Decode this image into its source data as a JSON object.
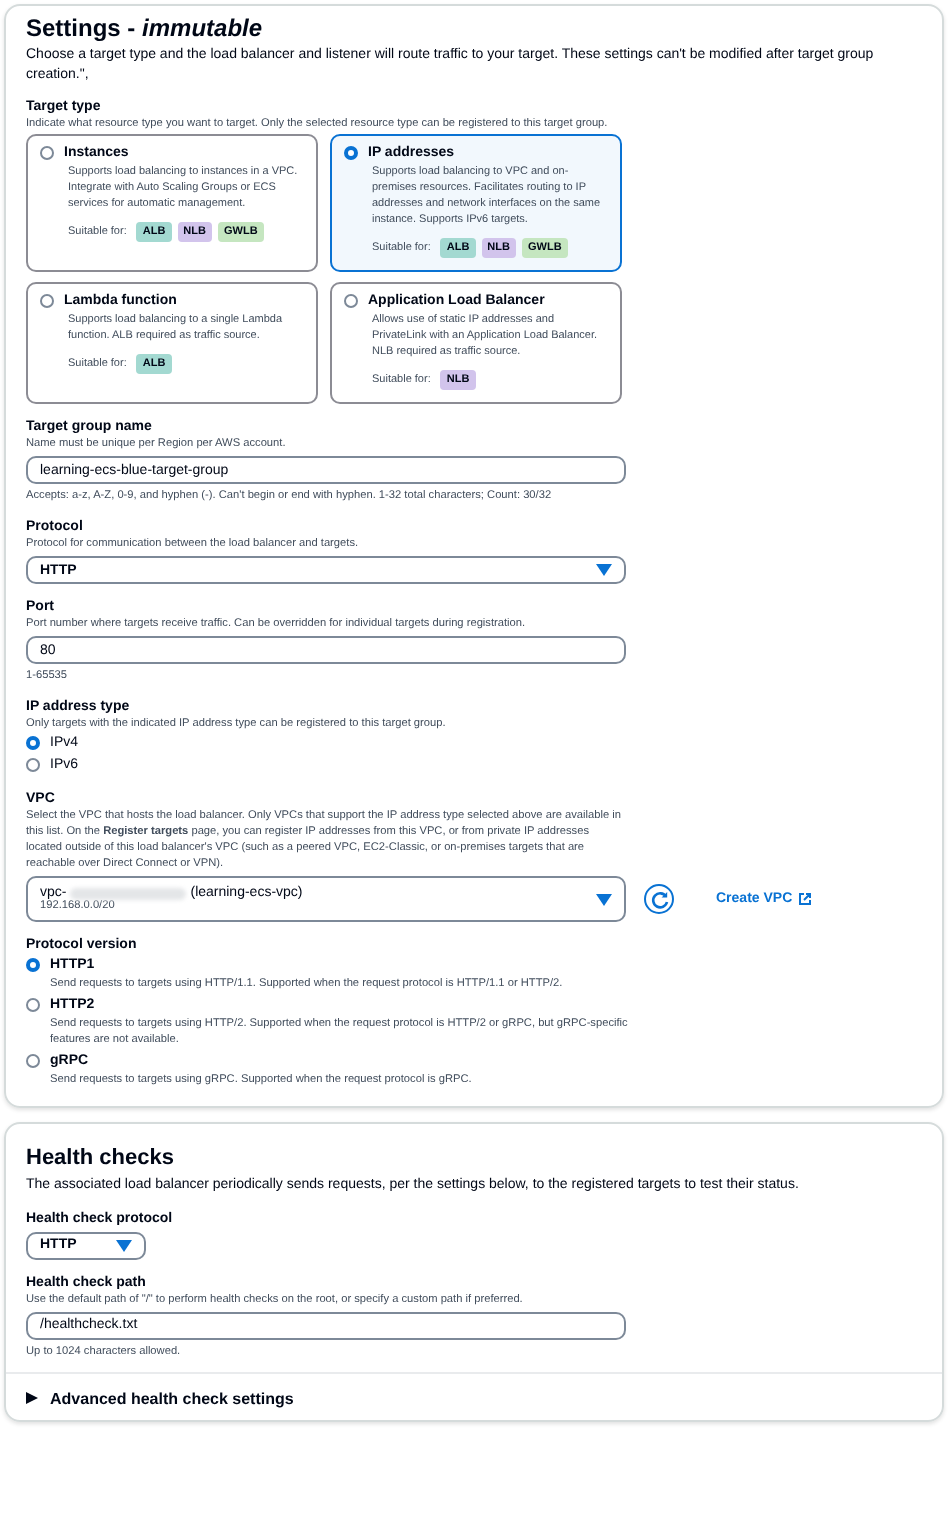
{
  "settings": {
    "title": "Settings - *immutable*",
    "description": "Choose a target type and the load balancer and listener will route traffic to your target. These settings can't be modified after target group creation.\",",
    "target_type": {
      "label": "Target type",
      "hint": "Indicate what resource type you want to target. Only the selected resource type can be registered to this target group.",
      "options": [
        {
          "title": "Instances",
          "description": "Supports load balancing to instances in a VPC. Integrate with Auto Scaling Groups or ECS services for automatic management.",
          "suitable_label": "Suitable for:",
          "selected": false,
          "tags": [
            {
              "label": "ALB",
              "color": "#a3d9d1"
            },
            {
              "label": "NLB",
              "color": "#d2c4ec"
            },
            {
              "label": "GWLB",
              "color": "#c5e6c0"
            }
          ]
        },
        {
          "title": "IP addresses",
          "description": "Supports load balancing to VPC and on-premises resources. Facilitates routing to IP addresses and network interfaces on the same instance. Supports IPv6 targets.",
          "suitable_label": "Suitable for:",
          "selected": true,
          "tags": [
            {
              "label": "ALB",
              "color": "#a3d9d1"
            },
            {
              "label": "NLB",
              "color": "#d2c4ec"
            },
            {
              "label": "GWLB",
              "color": "#c5e6c0"
            }
          ]
        },
        {
          "title": "Lambda function",
          "description": "Supports load balancing to a single Lambda function. ALB required as traffic source.",
          "suitable_label": "Suitable for:",
          "selected": false,
          "tags": [
            {
              "label": "ALB",
              "color": "#a3d9d1"
            }
          ]
        },
        {
          "title": "Application Load Balancer",
          "description": "Allows use of static IP addresses and PrivateLink with an Application Load Balancer. NLB required as traffic source.",
          "suitable_label": "Suitable for:",
          "selected": false,
          "tags": [
            {
              "label": "NLB",
              "color": "#d2c4ec"
            }
          ]
        }
      ]
    },
    "name": {
      "label": "Target group name",
      "hint": "Name must be unique per Region per AWS account.",
      "value": "learning-ecs-blue-target-group",
      "constraint": "Accepts: a-z, A-Z, 0-9, and hyphen (-). Can't begin or end with hyphen. 1-32 total characters; Count: 30/32"
    },
    "protocol": {
      "label": "Protocol",
      "hint": "Protocol for communication between the load balancer and targets.",
      "value": "HTTP"
    },
    "port": {
      "label": "Port",
      "hint": "Port number where targets receive traffic. Can be overridden for individual targets during registration.",
      "value": "80",
      "constraint": "1-65535"
    },
    "ip_address_type": {
      "label": "IP address type",
      "hint": "Only targets with the indicated IP address type can be registered to this target group.",
      "options": [
        {
          "label": "IPv4",
          "selected": true
        },
        {
          "label": "IPv6",
          "selected": false
        }
      ]
    },
    "vpc": {
      "label": "VPC",
      "hint": "Select the VPC that hosts the load balancer. Only VPCs that support the IP address type selected above are available in this list. On the **Register targets** page, you can register IP addresses from this VPC, or from private IP addresses located outside of this load balancer's VPC (such as a peered VPC, EC2-Classic, or on-premises targets that are reachable over Direct Connect or VPN).",
      "value_prefix": "vpc-",
      "value_name": "(learning-ecs-vpc)",
      "cidr": "192.168.0.0/20",
      "create_link": "Create VPC"
    },
    "protocol_version": {
      "label": "Protocol version",
      "options": [
        {
          "label": "HTTP1",
          "description": "Send requests to targets using HTTP/1.1. Supported when the request protocol is HTTP/1.1 or HTTP/2.",
          "selected": true
        },
        {
          "label": "HTTP2",
          "description": "Send requests to targets using HTTP/2. Supported when the request protocol is HTTP/2 or gRPC, but gRPC-specific features are not available.",
          "selected": false
        },
        {
          "label": "gRPC",
          "description": "Send requests to targets using gRPC. Supported when the request protocol is gRPC.",
          "selected": false
        }
      ]
    }
  },
  "health_checks": {
    "title": "Health checks",
    "description": "The associated load balancer periodically sends requests, per the settings below, to the registered targets to test their status.",
    "protocol": {
      "label": "Health check protocol",
      "value": "HTTP"
    },
    "path": {
      "label": "Health check path",
      "hint": "Use the default path of \"/\" to perform health checks on the root, or specify a custom path if preferred.",
      "value": "/healthcheck.txt",
      "constraint": "Up to 1024 characters allowed."
    },
    "advanced": {
      "label": "Advanced health check settings",
      "expanded": false
    }
  }
}
